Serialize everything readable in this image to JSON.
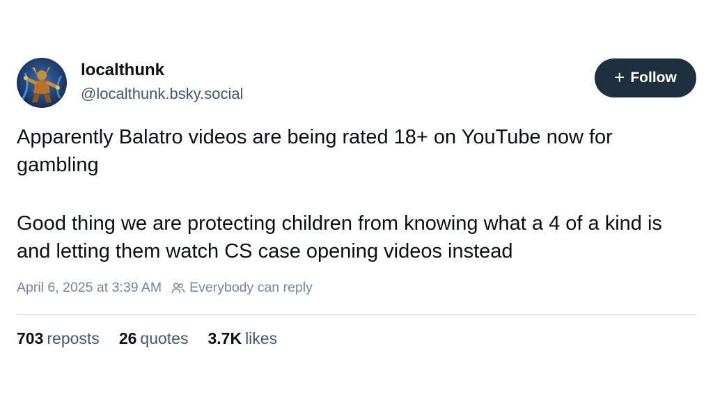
{
  "author": {
    "display_name": "localthunk",
    "handle": "@localthunk.bsky.social",
    "avatar_icon": "balatro-jester-avatar"
  },
  "follow_button": {
    "icon": "+",
    "label": "Follow"
  },
  "post": {
    "paragraphs": [
      "Apparently Balatro videos are being rated 18+ on YouTube now for gambling",
      "Good thing we are protecting children from knowing what a 4 of a kind is and letting them watch CS case opening videos instead"
    ],
    "timestamp": "April 6, 2025 at 3:39 AM",
    "reply_setting": "Everybody can reply",
    "reply_icon": "people-icon"
  },
  "stats": {
    "reposts": {
      "count": "703",
      "label": "reposts"
    },
    "quotes": {
      "count": "26",
      "label": "quotes"
    },
    "likes": {
      "count": "3.7K",
      "label": "likes"
    }
  },
  "colors": {
    "follow_bg": "#1e2f40",
    "text": "#0b0f14",
    "muted": "#42576c",
    "meta": "#6f869f",
    "divider": "#d4dbe2"
  }
}
